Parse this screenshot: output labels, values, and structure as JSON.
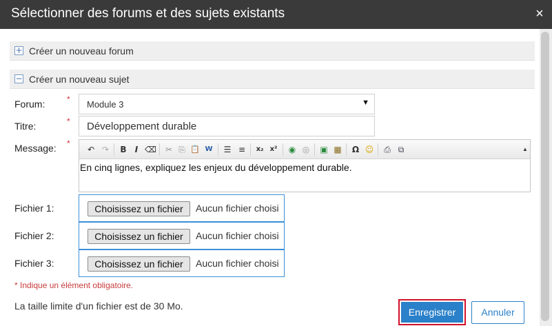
{
  "dialog": {
    "title": "Sélectionner des forums et des sujets existants",
    "close_icon": "×"
  },
  "sections": {
    "new_forum": {
      "toggle": "+",
      "label": "Créer un nouveau forum"
    },
    "new_topic": {
      "toggle": "−",
      "label": "Créer un nouveau sujet"
    }
  },
  "form": {
    "required_mark": "*",
    "forum": {
      "label": "Forum:",
      "value": "Module 3",
      "caret": "▼"
    },
    "title": {
      "label": "Titre:",
      "value": "Développement durable"
    },
    "message": {
      "label": "Message:",
      "body": "En cinq lignes, expliquez les enjeux du développement durable.",
      "toolbar": {
        "undo": "↶",
        "redo": "↷",
        "bold": "B",
        "italic": "I",
        "remove_format": "⌫",
        "cut": "✂",
        "copy": "⎘",
        "paste": "📋",
        "paste_word": "W",
        "bulleted_list": "☰",
        "numbered_list": "≡",
        "subscript": "x₂",
        "superscript": "x²",
        "link": "◉",
        "unlink": "◎",
        "image": "▣",
        "table": "▦",
        "special_char": "Ω",
        "smiley": "☺",
        "print": "⎙",
        "source": "⧉",
        "collapse": "▲"
      }
    },
    "files": [
      {
        "label": "Fichier 1:",
        "button": "Choisissez un fichier",
        "status": "Aucun fichier choisi"
      },
      {
        "label": "Fichier 2:",
        "button": "Choisissez un fichier",
        "status": "Aucun fichier choisi"
      },
      {
        "label": "Fichier 3:",
        "button": "Choisissez un fichier",
        "status": "Aucun fichier choisi"
      }
    ],
    "required_note": "* Indique un élément obligatoire.",
    "size_note": "La taille limite d'un fichier est de 30 Mo."
  },
  "actions": {
    "save": "Enregistrer",
    "cancel": "Annuler"
  },
  "colors": {
    "titlebar": "#3a3a3a",
    "accent": "#2a80c9",
    "required": "#d2333a",
    "highlight_border": "#d0102a"
  }
}
